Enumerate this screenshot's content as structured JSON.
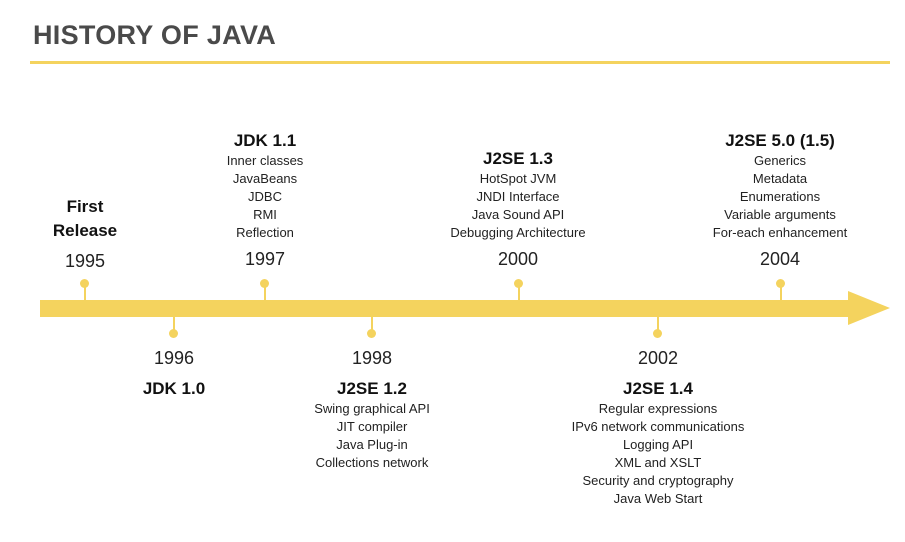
{
  "title": "HISTORY OF JAVA",
  "colors": {
    "accent": "#f4d35e",
    "title": "#4a4a4a"
  },
  "above": {
    "first": {
      "heading_line1": "First",
      "heading_line2": "Release",
      "year": "1995"
    },
    "jdk11": {
      "heading": "JDK 1.1",
      "items": [
        "Inner classes",
        "JavaBeans",
        "JDBC",
        "RMI",
        "Reflection"
      ],
      "year": "1997"
    },
    "j2se13": {
      "heading": "J2SE 1.3",
      "items": [
        "HotSpot JVM",
        "JNDI Interface",
        "Java Sound API",
        "Debugging Architecture"
      ],
      "year": "2000"
    },
    "j2se50": {
      "heading": "J2SE 5.0 (1.5)",
      "items": [
        "Generics",
        "Metadata",
        "Enumerations",
        "Variable arguments",
        "For-each enhancement"
      ],
      "year": "2004"
    }
  },
  "below": {
    "jdk10": {
      "year": "1996",
      "heading": "JDK 1.0"
    },
    "j2se12": {
      "year": "1998",
      "heading": "J2SE 1.2",
      "items": [
        "Swing graphical API",
        "JIT compiler",
        "Java Plug-in",
        "Collections network"
      ]
    },
    "j2se14": {
      "year": "2002",
      "heading": "J2SE 1.4",
      "items": [
        "Regular expressions",
        "IPv6 network communications",
        "Logging API",
        "XML and XSLT",
        "Security and cryptography",
        "Java Web Start"
      ]
    }
  }
}
